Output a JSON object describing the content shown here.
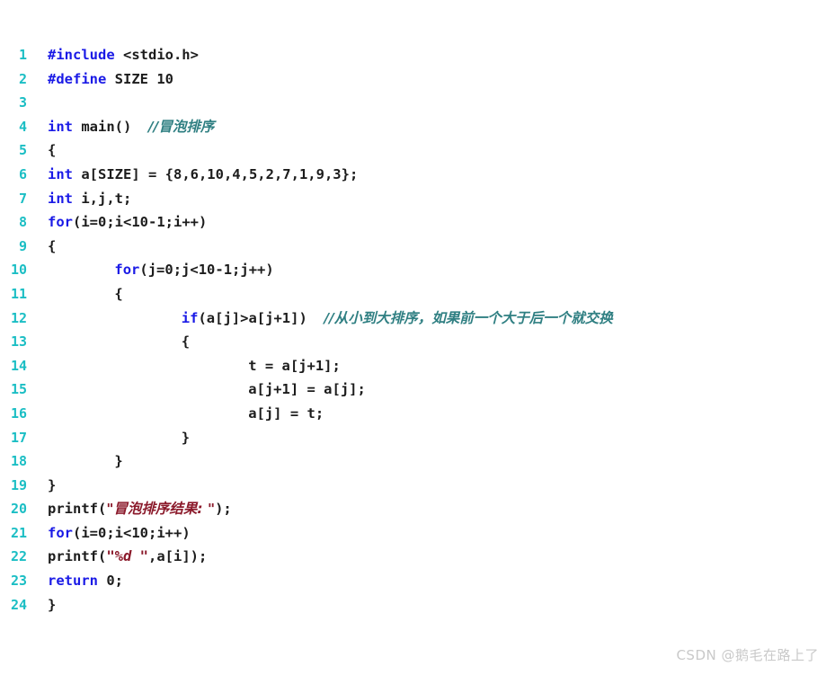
{
  "document": {
    "kind": "source-code-listing",
    "language": "C",
    "background_color": "#ffffff"
  },
  "theme": {
    "line_number_color": "#1bbec4",
    "keyword_color": "#1a1ae6",
    "preprocessor_color": "#1a1ae6",
    "plain_color": "#1c1c1c",
    "comment_color": "#2f7f82",
    "string_color": "#8b1a2b",
    "watermark_color": "#c9c9c9"
  },
  "code": {
    "lines": [
      {
        "number": "1",
        "indent": 0,
        "tokens": [
          {
            "t": "#include",
            "k": "pre"
          },
          {
            "t": " <stdio.h>",
            "k": "plain"
          }
        ]
      },
      {
        "number": "2",
        "indent": 0,
        "tokens": [
          {
            "t": "#define",
            "k": "pre"
          },
          {
            "t": " SIZE 10",
            "k": "plain"
          }
        ]
      },
      {
        "number": "3",
        "indent": 0,
        "tokens": []
      },
      {
        "number": "4",
        "indent": 0,
        "tokens": [
          {
            "t": "int",
            "k": "kw"
          },
          {
            "t": " main()  ",
            "k": "plain"
          },
          {
            "t": "//冒泡排序",
            "k": "comment"
          }
        ]
      },
      {
        "number": "5",
        "indent": 0,
        "tokens": [
          {
            "t": "{",
            "k": "plain"
          }
        ]
      },
      {
        "number": "6",
        "indent": 0,
        "tokens": [
          {
            "t": "int",
            "k": "kw"
          },
          {
            "t": " a[SIZE] = {8,6,10,4,5,2,7,1,9,3};",
            "k": "plain"
          }
        ]
      },
      {
        "number": "7",
        "indent": 0,
        "tokens": [
          {
            "t": "int",
            "k": "kw"
          },
          {
            "t": " i,j,t;",
            "k": "plain"
          }
        ]
      },
      {
        "number": "8",
        "indent": 0,
        "tokens": [
          {
            "t": "for",
            "k": "kw"
          },
          {
            "t": "(i=0;i<10-1;i++)",
            "k": "plain"
          }
        ]
      },
      {
        "number": "9",
        "indent": 0,
        "tokens": [
          {
            "t": "{",
            "k": "plain"
          }
        ]
      },
      {
        "number": "10",
        "indent": 8,
        "tokens": [
          {
            "t": "for",
            "k": "kw"
          },
          {
            "t": "(j=0;j<10-1;j++)",
            "k": "plain"
          }
        ]
      },
      {
        "number": "11",
        "indent": 8,
        "tokens": [
          {
            "t": "{",
            "k": "plain"
          }
        ]
      },
      {
        "number": "12",
        "indent": 16,
        "tokens": [
          {
            "t": "if",
            "k": "kw"
          },
          {
            "t": "(a[j]>a[j+1])  ",
            "k": "plain"
          },
          {
            "t": "//从小到大排序，如果前一个大于后一个就交换",
            "k": "comment"
          }
        ]
      },
      {
        "number": "13",
        "indent": 16,
        "tokens": [
          {
            "t": "{",
            "k": "plain"
          }
        ]
      },
      {
        "number": "14",
        "indent": 24,
        "tokens": [
          {
            "t": "t = a[j+1];",
            "k": "plain"
          }
        ]
      },
      {
        "number": "15",
        "indent": 24,
        "tokens": [
          {
            "t": "a[j+1] = a[j];",
            "k": "plain"
          }
        ]
      },
      {
        "number": "16",
        "indent": 24,
        "tokens": [
          {
            "t": "a[j] = t;",
            "k": "plain"
          }
        ]
      },
      {
        "number": "17",
        "indent": 16,
        "tokens": [
          {
            "t": "}",
            "k": "plain"
          }
        ]
      },
      {
        "number": "18",
        "indent": 8,
        "tokens": [
          {
            "t": "}",
            "k": "plain"
          }
        ]
      },
      {
        "number": "19",
        "indent": 0,
        "tokens": [
          {
            "t": "}",
            "k": "plain"
          }
        ]
      },
      {
        "number": "20",
        "indent": 0,
        "tokens": [
          {
            "t": "printf(",
            "k": "plain"
          },
          {
            "t": "\"冒泡排序结果: \"",
            "k": "string-cn"
          },
          {
            "t": ");",
            "k": "plain"
          }
        ]
      },
      {
        "number": "21",
        "indent": 0,
        "tokens": [
          {
            "t": "for",
            "k": "kw"
          },
          {
            "t": "(i=0;i<10;i++)",
            "k": "plain"
          }
        ]
      },
      {
        "number": "22",
        "indent": 0,
        "tokens": [
          {
            "t": "printf(",
            "k": "plain"
          },
          {
            "t": "\"%d \"",
            "k": "string"
          },
          {
            "t": ",a[i]);",
            "k": "plain"
          }
        ]
      },
      {
        "number": "23",
        "indent": 0,
        "tokens": [
          {
            "t": "return",
            "k": "kw"
          },
          {
            "t": " 0;",
            "k": "plain"
          }
        ]
      },
      {
        "number": "24",
        "indent": 0,
        "tokens": [
          {
            "t": "}",
            "k": "plain"
          }
        ]
      }
    ]
  },
  "watermark": {
    "text": "CSDN @鹅毛在路上了"
  }
}
